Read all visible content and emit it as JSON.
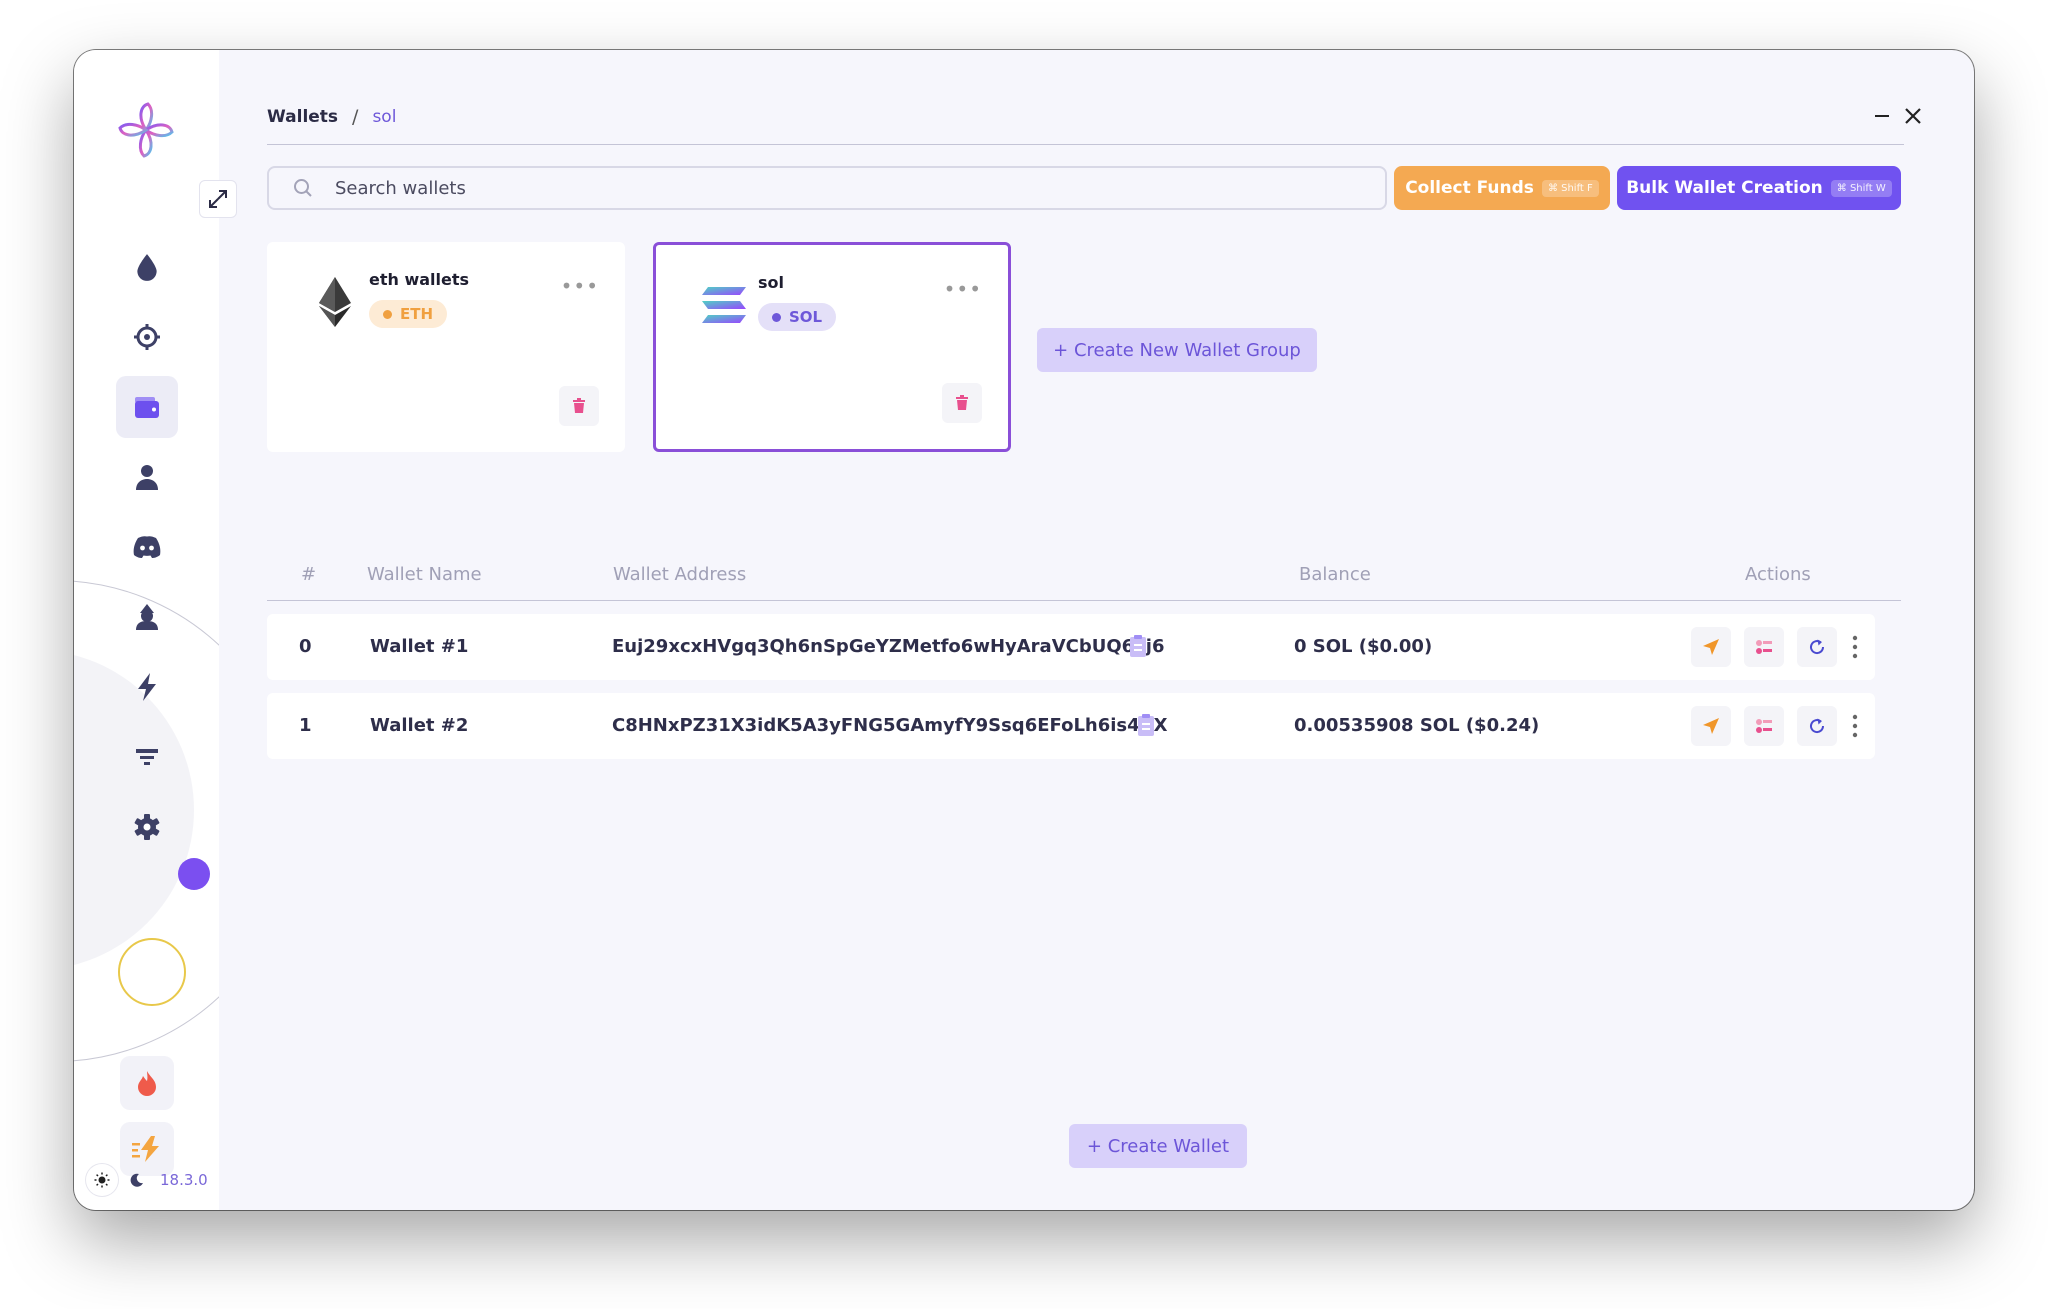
{
  "breadcrumb": {
    "root": "Wallets",
    "separator": "/",
    "current": "sol"
  },
  "search": {
    "placeholder": "Search wallets"
  },
  "toolbar": {
    "collect_label": "Collect Funds",
    "collect_shortcut": "⌘ Shift F",
    "bulk_label": "Bulk Wallet Creation",
    "bulk_shortcut": "⌘ Shift W"
  },
  "groups": [
    {
      "name": "eth wallets",
      "chip": "ETH",
      "chip_color": "#f0a040",
      "chip_bg": "#fdebd5",
      "icon": "ethereum-icon"
    },
    {
      "name": "sol",
      "chip": "SOL",
      "chip_color": "#6e58d9",
      "chip_bg": "#e4e0f8",
      "icon": "solana-icon",
      "selected": true
    }
  ],
  "create_group_label": "+ Create New Wallet Group",
  "table": {
    "headers": {
      "index": "#",
      "name": "Wallet Name",
      "address": "Wallet Address",
      "balance": "Balance",
      "actions": "Actions"
    },
    "rows": [
      {
        "index": "0",
        "name": "Wallet #1",
        "address": "Euj29xcxHVgq3Qh6nSpGeYZMetfo6wHyAraVCbUQ6xj6",
        "balance": "0 SOL ($0.00)"
      },
      {
        "index": "1",
        "name": "Wallet #2",
        "address": "C8HNxPZ31X3idK5A3yFNG5GAmyfY9Ssq6EFoLh6is4AX",
        "balance": "0.00535908 SOL ($0.24)"
      }
    ]
  },
  "create_wallet_label": "+ Create Wallet",
  "version": "18.3.0",
  "colors": {
    "accent": "#7052f0",
    "orange": "#f4a952",
    "selected_border": "#8a4fd8"
  }
}
